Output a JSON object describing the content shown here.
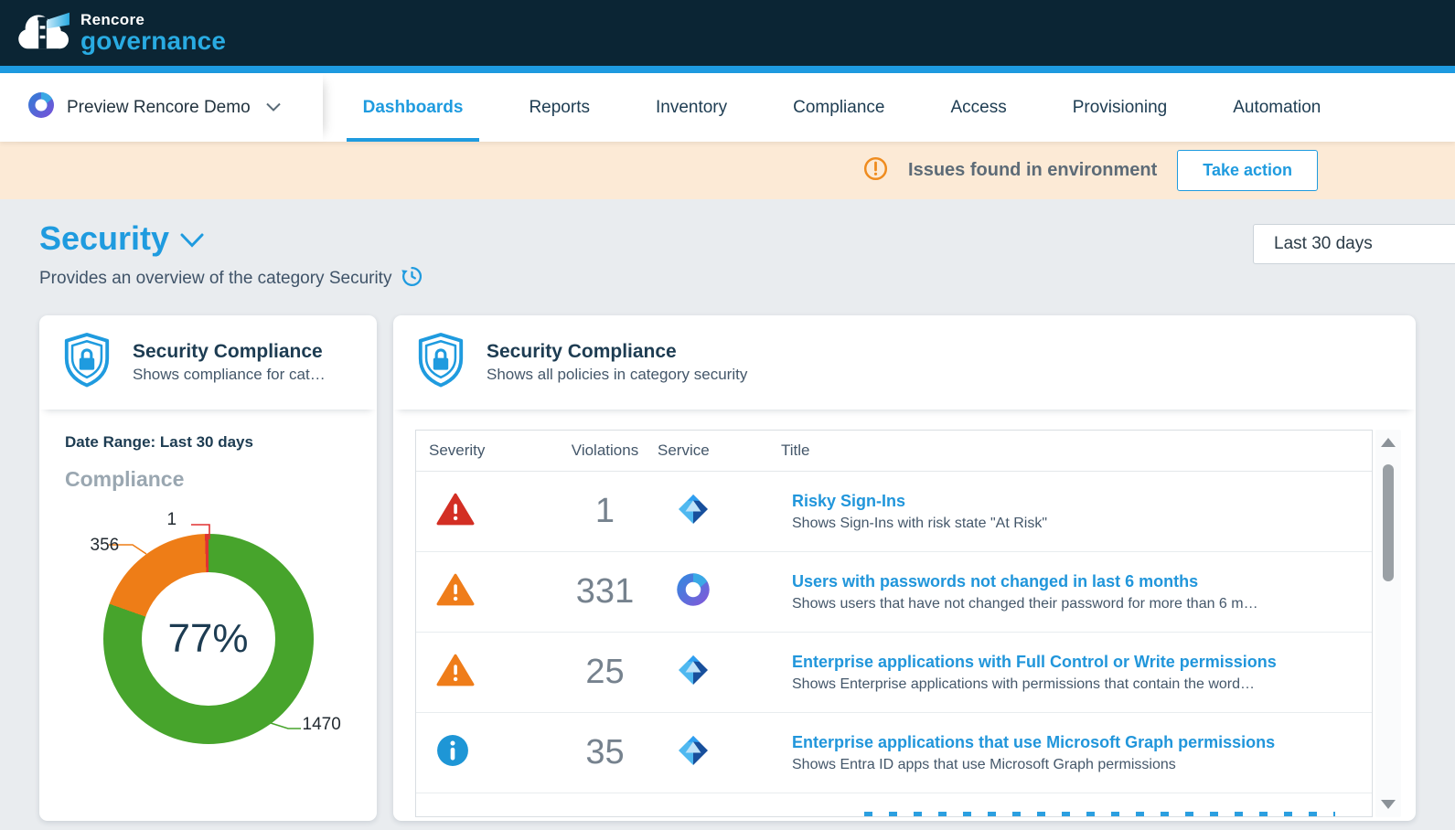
{
  "brand": {
    "name_top": "Rencore",
    "name_bottom": "governance"
  },
  "nav": {
    "org": {
      "label": "Preview Rencore Demo"
    },
    "tabs": [
      {
        "label": "Dashboards",
        "active": true
      },
      {
        "label": "Reports",
        "active": false
      },
      {
        "label": "Inventory",
        "active": false
      },
      {
        "label": "Compliance",
        "active": false
      },
      {
        "label": "Access",
        "active": false
      },
      {
        "label": "Provisioning",
        "active": false
      },
      {
        "label": "Automation",
        "active": false
      }
    ]
  },
  "banner": {
    "message": "Issues found in environment",
    "action_label": "Take action"
  },
  "page": {
    "title": "Security",
    "subtitle": "Provides an overview of the category Security",
    "date_filter": "Last 30 days"
  },
  "colors": {
    "accent_blue": "#1f9bdf",
    "header_navy": "#0b2534",
    "banner_bg": "#fcead6",
    "donut_green": "#47a42c",
    "donut_orange": "#ee7d17",
    "donut_red": "#e03131",
    "severity_critical": "#d32f24",
    "severity_warning": "#ef7d1a",
    "severity_info": "#1e96d6"
  },
  "left_card": {
    "title": "Security Compliance",
    "subtitle": "Shows compliance for cat…",
    "date_range_label": "Date Range: Last 30 days",
    "section_label": "Compliance"
  },
  "chart_data": {
    "type": "pie",
    "title": "Compliance",
    "center_label": "77%",
    "labels": [
      "1470",
      "356",
      "1"
    ],
    "values": [
      1470,
      356,
      1
    ],
    "colors": [
      "#47a42c",
      "#ee7d17",
      "#e03131"
    ],
    "legend_position": "none",
    "donut": true
  },
  "right_card": {
    "title": "Security Compliance",
    "subtitle": "Shows all policies in category security",
    "table": {
      "columns": [
        "Severity",
        "Violations",
        "Service",
        "Title"
      ],
      "rows": [
        {
          "severity": "critical",
          "violations": "1",
          "service": "entra-id",
          "title": "Risky Sign-Ins",
          "description": "Shows Sign-Ins with risk state \"At Risk\""
        },
        {
          "severity": "warning",
          "violations": "331",
          "service": "microsoft-365",
          "title": "Users with passwords not changed in last 6 months",
          "description": "Shows users that have not changed their password for more than 6 m…"
        },
        {
          "severity": "warning",
          "violations": "25",
          "service": "entra-id",
          "title": "Enterprise applications with Full Control or Write permissions",
          "description": "Shows Enterprise applications with permissions that contain the word…"
        },
        {
          "severity": "info",
          "violations": "35",
          "service": "entra-id",
          "title": "Enterprise applications that use Microsoft Graph permissions",
          "description": "Shows Entra ID apps that use Microsoft Graph permissions"
        }
      ],
      "has_partial_next_row": true
    }
  }
}
